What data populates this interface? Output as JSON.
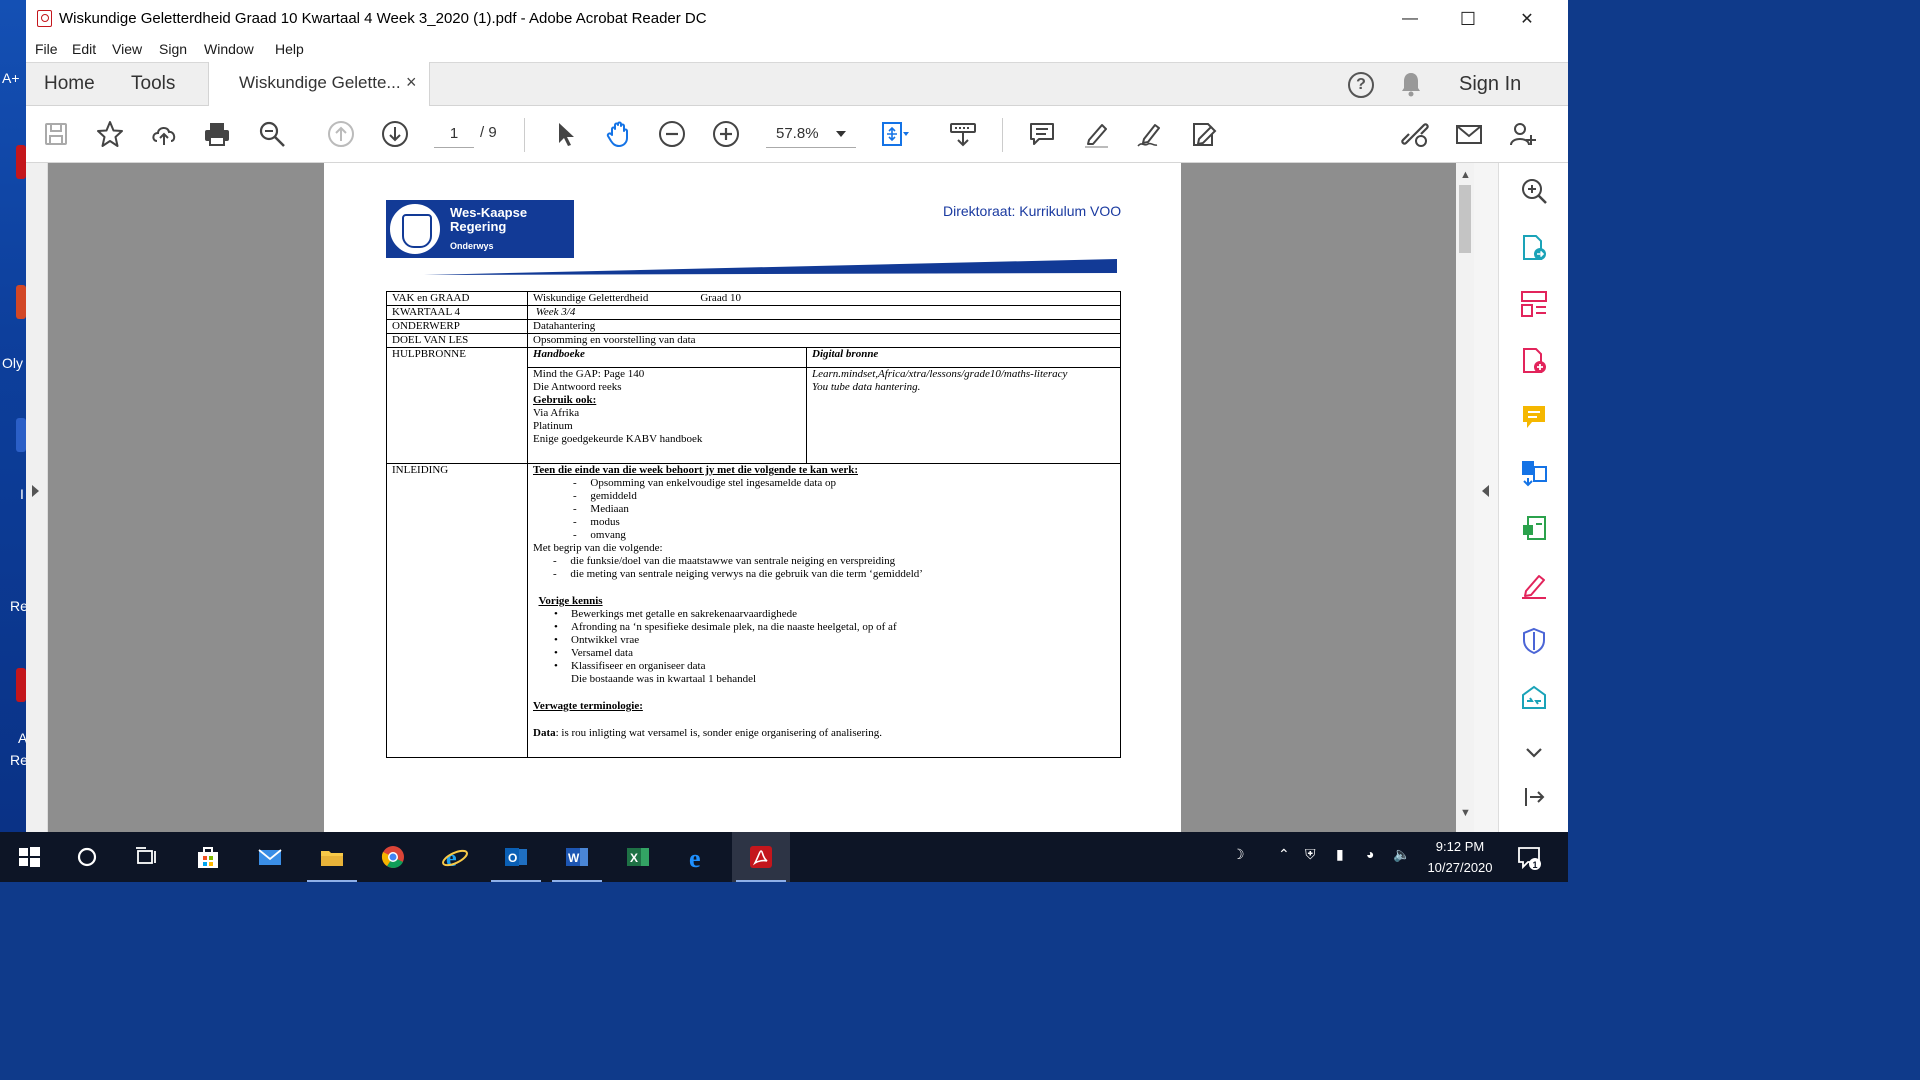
{
  "desktop": {
    "fragments": [
      "A+",
      "Oly",
      "I",
      "Re",
      "A",
      "Re"
    ]
  },
  "window": {
    "title": "Wiskundige Geletterdheid Graad 10 Kwartaal 4 Week 3_2020 (1).pdf - Adobe Acrobat Reader DC",
    "controls": {
      "minimize": "—",
      "maximize": "☐",
      "close": "✕"
    }
  },
  "menu": [
    "File",
    "Edit",
    "View",
    "Sign",
    "Window",
    "Help"
  ],
  "tabs": {
    "home": "Home",
    "tools": "Tools",
    "document": "Wiskundige Gelette...",
    "close": "×",
    "help": "?",
    "sign_in": "Sign In"
  },
  "toolbar": {
    "current_page": "1",
    "page_sep": "/  9",
    "zoom": "57.8%"
  },
  "pdf": {
    "logo": {
      "line1": "Wes-Kaapse",
      "line2": "Regering",
      "line3": "Onderwys"
    },
    "directorate": "Direktoraat: Kurrikulum VOO",
    "rows": {
      "vak_label": "VAK en GRAAD",
      "vak_value": "Wiskundige Geletterdheid",
      "graad": "Graad 10",
      "kwartaal_label": "KWARTAAL 4",
      "kwartaal_value": "Week 3/4",
      "onderwerp_label": "ONDERWERP",
      "onderwerp_value": "Datahantering",
      "doel_label": "DOEL VAN LES",
      "doel_value": "Opsomming en voorstelling van data",
      "hulp_label": "HULPBRONNE",
      "handboeke_header": "Handboeke",
      "digital_header": "Digital bronne",
      "handboeke": {
        "line1": "Mind the GAP: Page 140",
        "line2": "Die Antwoord reeks",
        "gebruik": "Gebruik ook:",
        "line3": "Via Afrika",
        "line4": "Platinum",
        "line5": "Enige goedgekeurde KABV handboek"
      },
      "digital": {
        "line1": "Learn.mindset,Africa/xtra/lessons/grade10/maths-literacy",
        "line2": "You  tube data hantering."
      },
      "inleiding_label": "INLEIDING",
      "inleiding": {
        "heading": "Teen die einde van die week behoort jy met die volgende te kan werk:",
        "items": [
          "Opsomming van enkelvoudige stel ingesamelde data op",
          "gemiddeld",
          "Mediaan",
          "modus",
          "omvang"
        ],
        "begrip": "Met begrip van die volgende:",
        "begrip_items": [
          "die funksie/doel van die maatstawwe van sentrale neiging en verspreiding",
          "die meting van sentrale neiging verwys na die gebruik van die term ‘gemiddeld’"
        ],
        "vorige_heading": "Vorige kennis",
        "vorige_items": [
          "Bewerkings met getalle en sakrekenaarvaardighede",
          "Afronding na ‘n spesifieke desimale plek, na die naaste heelgetal, op of af",
          "Ontwikkel vrae",
          "Versamel data",
          "Klassifiseer en organiseer data"
        ],
        "vorige_note": "Die bostaande was in kwartaal 1 behandel",
        "terminologie_heading": "Verwagte terminologie:",
        "data_term": "Data",
        "data_def": ": is rou inligting wat versamel is, sonder enige organisering of analisering."
      }
    }
  },
  "taskbar": {
    "time": "9:12 PM",
    "date": "10/27/2020",
    "notification_count": "1"
  },
  "colors": {
    "acrobat_red": "#c4161c",
    "wcg_blue": "#123a96",
    "taskbar": "#0d1526",
    "canvas_gray": "#8e8e8e",
    "accent_blue": "#1473e6"
  }
}
